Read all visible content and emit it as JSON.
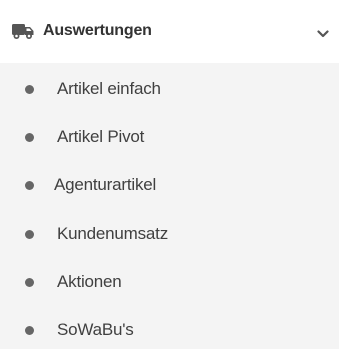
{
  "menu": {
    "header": {
      "label": "Auswertungen",
      "icon": "truck-icon",
      "toggle_icon": "chevron-down-icon",
      "expanded": true
    },
    "items": [
      {
        "label": "Artikel einfach",
        "icon": "bullet-icon"
      },
      {
        "label": "Artikel Pivot",
        "icon": "bullet-icon"
      },
      {
        "label": "Agenturartikel",
        "icon": "bullet-icon"
      },
      {
        "label": "Kundenumsatz",
        "icon": "bullet-icon"
      },
      {
        "label": "Aktionen",
        "icon": "bullet-icon"
      },
      {
        "label": "SoWaBu's",
        "icon": "bullet-icon"
      }
    ]
  },
  "colors": {
    "header_bg": "#ffffff",
    "submenu_bg": "#f4f4f4",
    "text": "#404040",
    "header_text": "#333333",
    "icon": "#555555",
    "bullet": "#666666"
  }
}
